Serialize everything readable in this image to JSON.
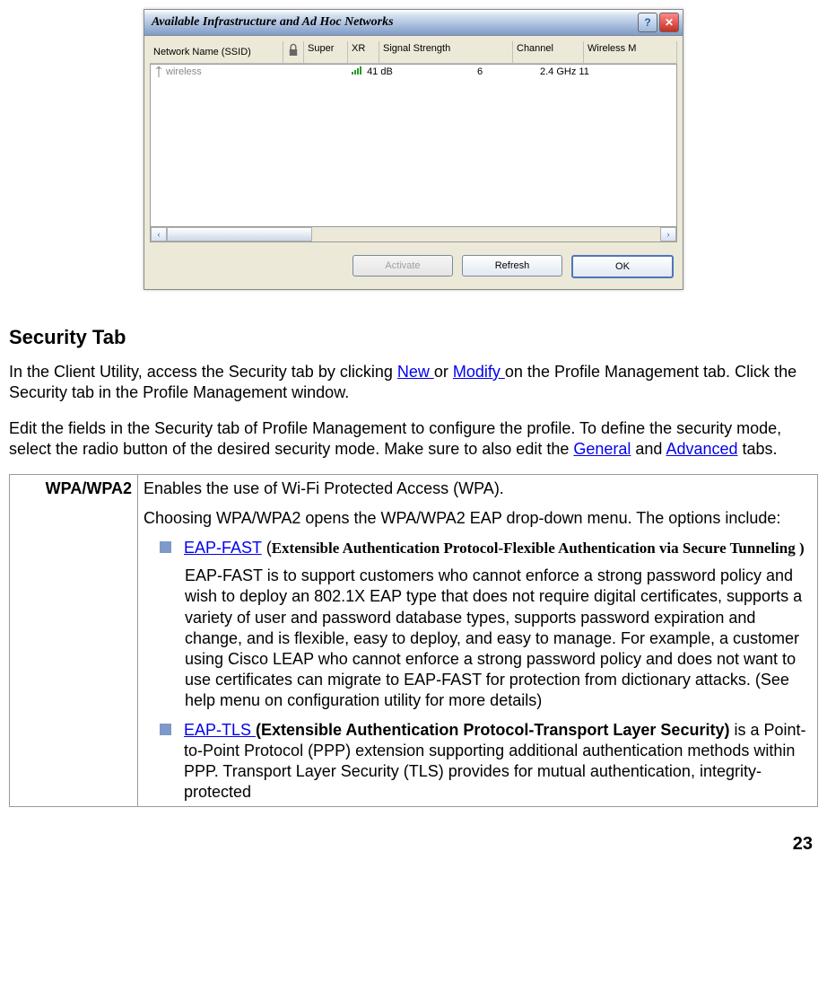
{
  "dialog": {
    "title": "Available Infrastructure and Ad Hoc Networks",
    "columns": {
      "ssid": "Network Name (SSID)",
      "super": "Super",
      "xr": "XR",
      "signal": "Signal Strength",
      "channel": "Channel",
      "wireless": "Wireless M"
    },
    "row": {
      "ssid": "wireless",
      "signal": "41 dB",
      "channel": "6",
      "wireless": "2.4 GHz 11"
    },
    "buttons": {
      "activate": "Activate",
      "refresh": "Refresh",
      "ok": "OK"
    }
  },
  "heading": "Security Tab",
  "para1": {
    "pre": "In the Client Utility, access the Security tab by clicking ",
    "link1": "New ",
    "mid": "or ",
    "link2": "Modify ",
    "post": "on the Profile Management tab.   Click the Security tab in the Profile Management window."
  },
  "para2": {
    "pre": "Edit the fields in the Security tab of Profile Management to configure the profile. To define the security mode, select the radio button of the desired security mode. Make sure to also edit the ",
    "link1": "General",
    "mid": " and ",
    "link2": "Advanced",
    "post": " tabs."
  },
  "table": {
    "rowLabel": "WPA/WPA2",
    "line1": "Enables the use of Wi-Fi Protected Access (WPA).",
    "line2": "Choosing WPA/WPA2 opens the WPA/WPA2 EAP drop-down menu. The options include:",
    "eapfast": {
      "link": "EAP-FAST",
      "paren": " (",
      "bold": "Extensible Authentication Protocol-Flexible Authentication via Secure Tunneling )",
      "desc": "EAP-FAST is to support customers who cannot enforce a strong password policy and wish to deploy an 802.1X EAP type that does not require digital certificates, supports a variety of user and password database types, supports password expiration and change, and is flexible, easy to deploy, and easy to manage. For example, a customer using Cisco LEAP who cannot enforce a strong password policy and does not want to use certificates can migrate to EAP-FAST for protection from dictionary attacks. (See help menu on configuration utility for more details)"
    },
    "eaptls": {
      "link": "EAP-TLS ",
      "bold": "(Extensible Authentication Protocol-Transport Layer Security)",
      "rest": " is a Point-to-Point Protocol (PPP) extension supporting additional authentication methods within PPP. Transport Layer Security (TLS) provides for mutual authentication, integrity-protected"
    }
  },
  "pageNumber": "23"
}
